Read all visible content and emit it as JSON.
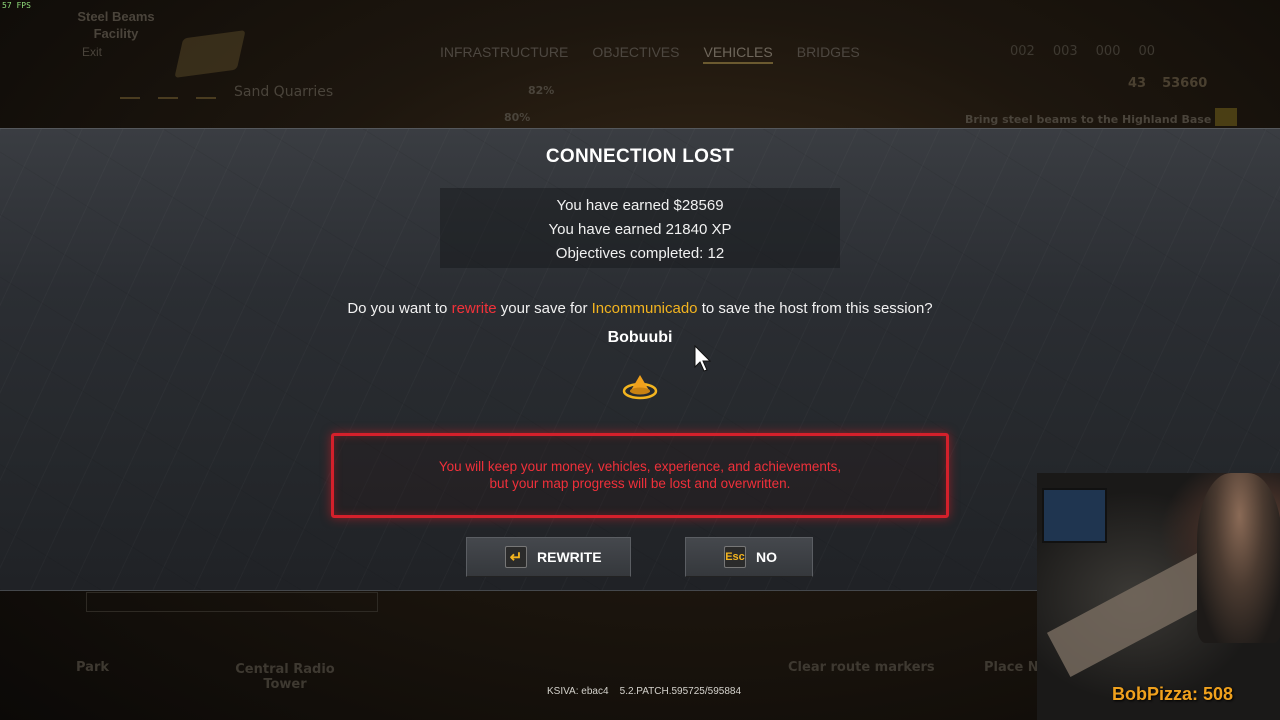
{
  "hud": {
    "fps": "57 FPS",
    "facility_name": "Steel Beams Facility",
    "exit_label": "Exit",
    "tabs": [
      {
        "label": "INFRASTRUCTURE",
        "active": false
      },
      {
        "label": "OBJECTIVES",
        "active": false
      },
      {
        "label": "VEHICLES",
        "active": true
      },
      {
        "label": "BRIDGES",
        "active": false
      }
    ],
    "stats_top": [
      "002",
      "003",
      "000",
      "00"
    ],
    "money_counter": "43",
    "money_total": "53660",
    "location": "Sand Quarries",
    "percent_1": "82%",
    "percent_2": "80%",
    "objective_hint": "Bring steel beams to the Highland Base",
    "bottom_left": "Park",
    "bottom_center": "Central Radio Tower",
    "bottom_right_1": "Clear route markers",
    "bottom_right_2": "Place N"
  },
  "dialog": {
    "title": "CONNECTION LOST",
    "summary": {
      "money": "You have earned $28569",
      "xp": "You have earned 21840 XP",
      "objectives": "Objectives completed: 12"
    },
    "question": {
      "part1": "Do you want to ",
      "rewrite_word": "rewrite",
      "part2": " your save for ",
      "save_name": "Incommunicado",
      "part3": " to save the host from this session?"
    },
    "host_player": "Bobuubi",
    "warning_line1": "You will keep your money, vehicles, experience, and achievements,",
    "warning_line2": "but your map progress will be lost and overwritten.",
    "buttons": {
      "rewrite_key": "↵",
      "rewrite_label": "REWRITE",
      "no_key": "Esc",
      "no_label": "NO"
    }
  },
  "footer": {
    "version": "KSIVA: ebac4    5.2.PATCH.595725/595884"
  },
  "overlay": {
    "stream_counter": "BobPizza: 508"
  },
  "colors": {
    "accent_red": "#f2323a",
    "accent_yellow": "#f3b41f",
    "warning_border": "#d4202b",
    "overlay_text": "#f0a11d"
  }
}
